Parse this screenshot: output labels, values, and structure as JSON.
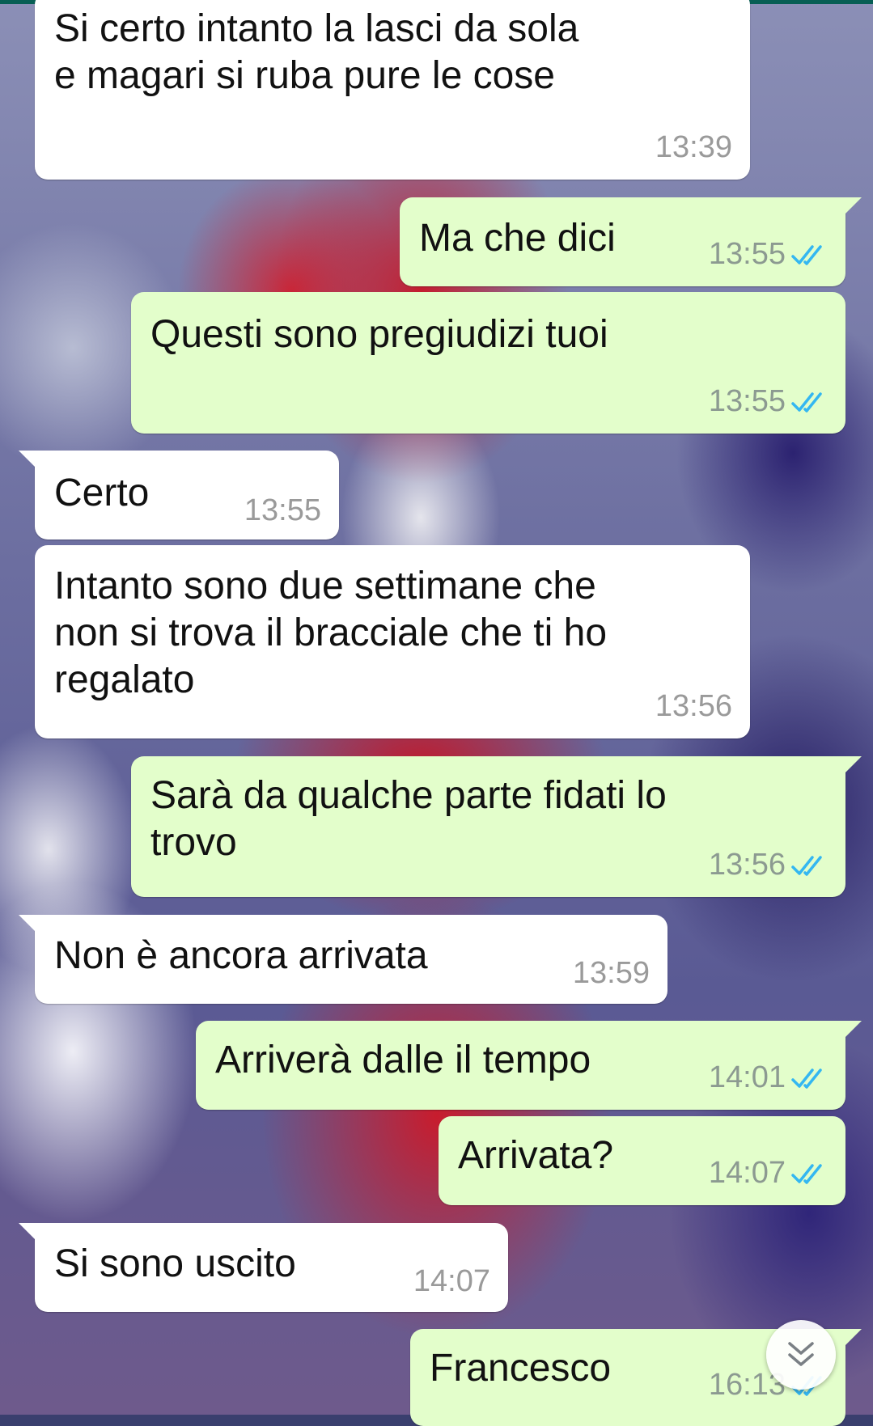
{
  "theme": {
    "incoming_bubble": "#ffffff",
    "outgoing_bubble": "#e3fecb",
    "read_ticks": "#34b7f1",
    "top_bar": "#075e54"
  },
  "messages": [
    {
      "direction": "incoming",
      "text_lines": [
        "Si certo intanto la lasci da sola",
        "e magari si ruba pure le cose"
      ],
      "time": "13:39"
    },
    {
      "direction": "outgoing",
      "text_lines": [
        "Ma che dici"
      ],
      "time": "13:55",
      "status": "read-double-check-icon"
    },
    {
      "direction": "outgoing",
      "text_lines": [
        "Questi sono pregiudizi tuoi"
      ],
      "time": "13:55",
      "status": "read-double-check-icon"
    },
    {
      "direction": "incoming",
      "text_lines": [
        "Certo"
      ],
      "time": "13:55"
    },
    {
      "direction": "incoming",
      "text_lines": [
        "Intanto sono due settimane che",
        "non si trova il bracciale che ti ho",
        "regalato"
      ],
      "time": "13:56"
    },
    {
      "direction": "outgoing",
      "text_lines": [
        "Sarà da qualche parte fidati lo",
        "trovo"
      ],
      "time": "13:56",
      "status": "read-double-check-icon"
    },
    {
      "direction": "incoming",
      "text_lines": [
        "Non è ancora arrivata"
      ],
      "time": "13:59"
    },
    {
      "direction": "outgoing",
      "text_lines": [
        "Arriverà dalle il tempo"
      ],
      "time": "14:01",
      "status": "read-double-check-icon"
    },
    {
      "direction": "outgoing",
      "text_lines": [
        "Arrivata?"
      ],
      "time": "14:07",
      "status": "read-double-check-icon"
    },
    {
      "direction": "incoming",
      "text_lines": [
        "Si sono uscito"
      ],
      "time": "14:07"
    },
    {
      "direction": "outgoing",
      "text_lines": [
        "Francesco"
      ],
      "time": "16:13",
      "status": "read-double-check-icon"
    }
  ],
  "scroll_button": {
    "icon": "double-chevron-down-icon"
  }
}
